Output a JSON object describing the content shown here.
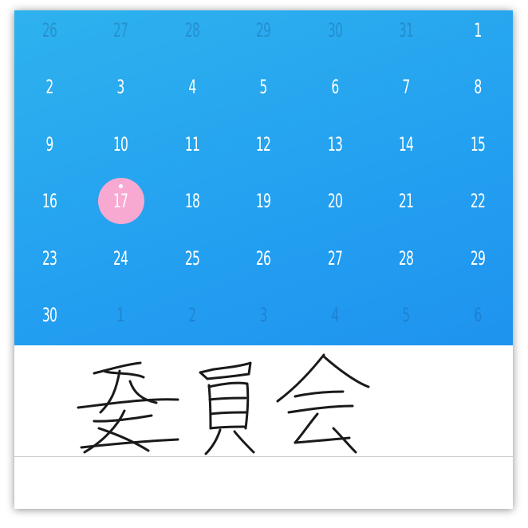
{
  "calendar": {
    "selected_day": "17",
    "weeks": [
      [
        {
          "d": "26",
          "muted": true
        },
        {
          "d": "27",
          "muted": true
        },
        {
          "d": "28",
          "muted": true
        },
        {
          "d": "29",
          "muted": true
        },
        {
          "d": "30",
          "muted": true
        },
        {
          "d": "31",
          "muted": true
        },
        {
          "d": "1",
          "muted": false
        }
      ],
      [
        {
          "d": "2",
          "muted": false
        },
        {
          "d": "3",
          "muted": false
        },
        {
          "d": "4",
          "muted": false
        },
        {
          "d": "5",
          "muted": false
        },
        {
          "d": "6",
          "muted": false
        },
        {
          "d": "7",
          "muted": false
        },
        {
          "d": "8",
          "muted": false
        }
      ],
      [
        {
          "d": "9",
          "muted": false
        },
        {
          "d": "10",
          "muted": false
        },
        {
          "d": "11",
          "muted": false
        },
        {
          "d": "12",
          "muted": false
        },
        {
          "d": "13",
          "muted": false
        },
        {
          "d": "14",
          "muted": false
        },
        {
          "d": "15",
          "muted": false
        }
      ],
      [
        {
          "d": "16",
          "muted": false
        },
        {
          "d": "17",
          "muted": false
        },
        {
          "d": "18",
          "muted": false
        },
        {
          "d": "19",
          "muted": false
        },
        {
          "d": "20",
          "muted": false
        },
        {
          "d": "21",
          "muted": false
        },
        {
          "d": "22",
          "muted": false
        }
      ],
      [
        {
          "d": "23",
          "muted": false
        },
        {
          "d": "24",
          "muted": false
        },
        {
          "d": "25",
          "muted": false
        },
        {
          "d": "26",
          "muted": false
        },
        {
          "d": "27",
          "muted": false
        },
        {
          "d": "28",
          "muted": false
        },
        {
          "d": "29",
          "muted": false
        }
      ],
      [
        {
          "d": "30",
          "muted": false
        },
        {
          "d": "1",
          "muted": true
        },
        {
          "d": "2",
          "muted": true
        },
        {
          "d": "3",
          "muted": true
        },
        {
          "d": "4",
          "muted": true
        },
        {
          "d": "5",
          "muted": true
        },
        {
          "d": "6",
          "muted": true
        }
      ]
    ]
  },
  "note": {
    "handwritten_text": "委員会"
  },
  "colors": {
    "calendar_bg_start": "#2eb2ee",
    "calendar_bg_end": "#1e93ef",
    "day_text": "#ffffff",
    "muted_day_text": "#5a86b0",
    "today_highlight": "#f7a9d2",
    "ink": "#1a1a1a"
  }
}
